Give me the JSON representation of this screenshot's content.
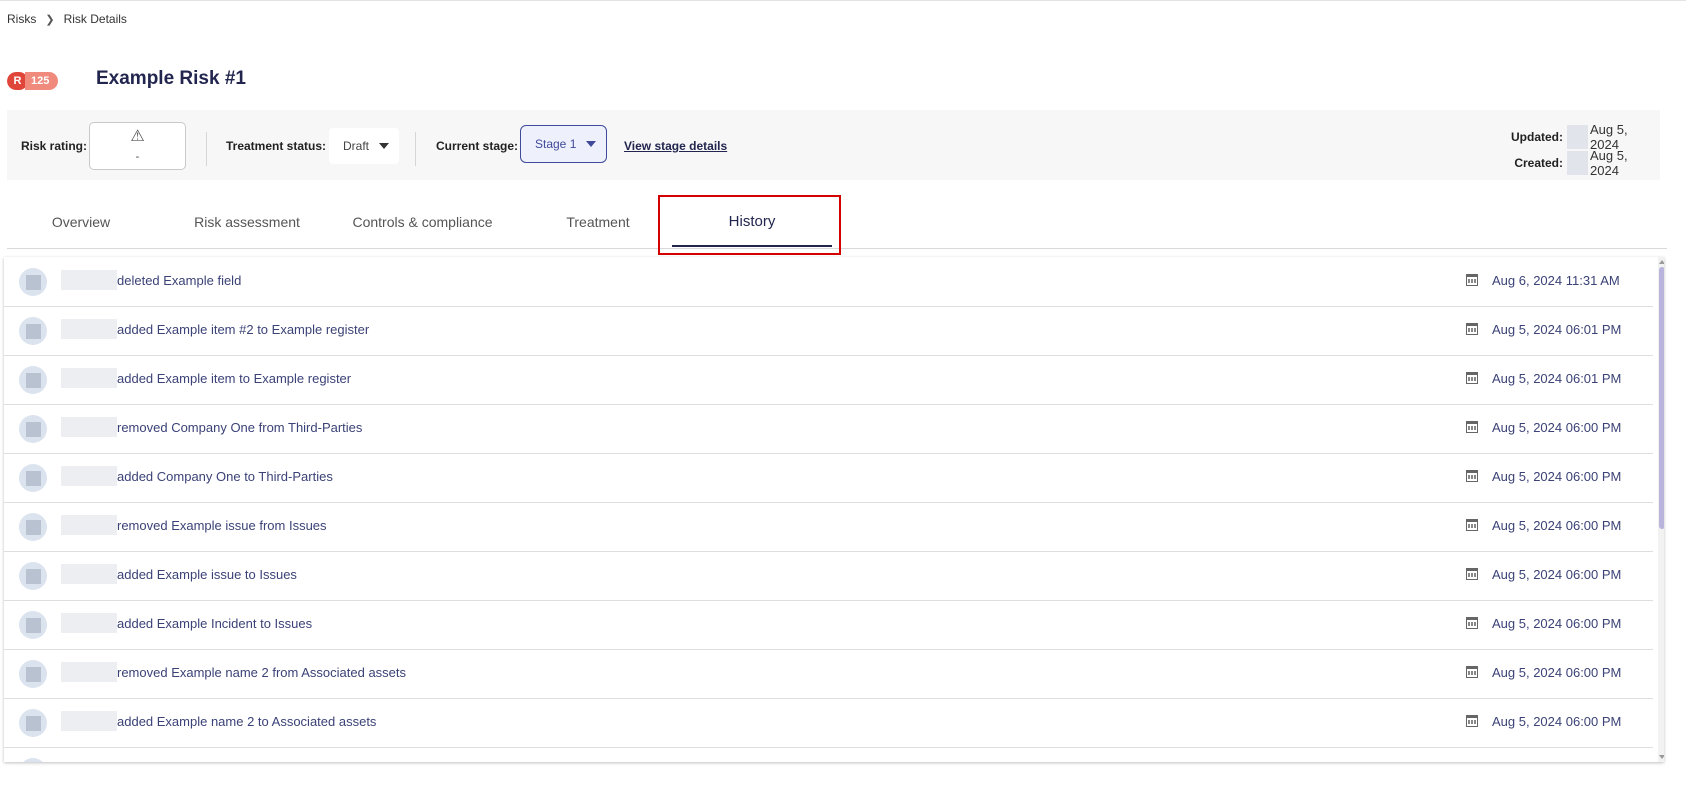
{
  "breadcrumb": {
    "root": "Risks",
    "current": "Risk Details"
  },
  "risk": {
    "badge_letter": "R",
    "badge_number": "125",
    "title": "Example Risk #1"
  },
  "info_bar": {
    "risk_rating_label": "Risk rating:",
    "risk_rating_icon": "warning-triangle-icon",
    "risk_rating_value": "-",
    "treatment_status_label": "Treatment status:",
    "treatment_status_value": "Draft",
    "current_stage_label": "Current stage:",
    "current_stage_value": "Stage 1",
    "view_stage_link": "View stage details",
    "updated_label": "Updated:",
    "updated_value": "Aug 5, 2024",
    "created_label": "Created:",
    "created_value": "Aug 5, 2024"
  },
  "tabs": [
    {
      "label": "Overview"
    },
    {
      "label": "Risk assessment"
    },
    {
      "label": "Controls & compliance"
    },
    {
      "label": "Treatment"
    },
    {
      "label": "History",
      "active": true
    }
  ],
  "history": [
    {
      "text": "deleted Example field",
      "timestamp": "Aug 6, 2024 11:31 AM"
    },
    {
      "text": "added Example item #2 to Example register",
      "timestamp": "Aug 5, 2024 06:01 PM"
    },
    {
      "text": "added Example item to Example register",
      "timestamp": "Aug 5, 2024 06:01 PM"
    },
    {
      "text": "removed Company One from Third-Parties",
      "timestamp": "Aug 5, 2024 06:00 PM"
    },
    {
      "text": "added Company One to Third-Parties",
      "timestamp": "Aug 5, 2024 06:00 PM"
    },
    {
      "text": "removed Example issue from Issues",
      "timestamp": "Aug 5, 2024 06:00 PM"
    },
    {
      "text": "added Example issue to Issues",
      "timestamp": "Aug 5, 2024 06:00 PM"
    },
    {
      "text": "added Example Incident to Issues",
      "timestamp": "Aug 5, 2024 06:00 PM"
    },
    {
      "text": "removed Example name 2 from Associated assets",
      "timestamp": "Aug 5, 2024 06:00 PM"
    },
    {
      "text": "added Example name 2 to Associated assets",
      "timestamp": "Aug 5, 2024 06:00 PM"
    }
  ],
  "colors": {
    "brand_navy": "#22264f",
    "badge_red": "#e0453a",
    "badge_salmon": "#ef8a7d",
    "highlight_red": "#d40000",
    "scroll_thumb": "#b8b4dc"
  }
}
